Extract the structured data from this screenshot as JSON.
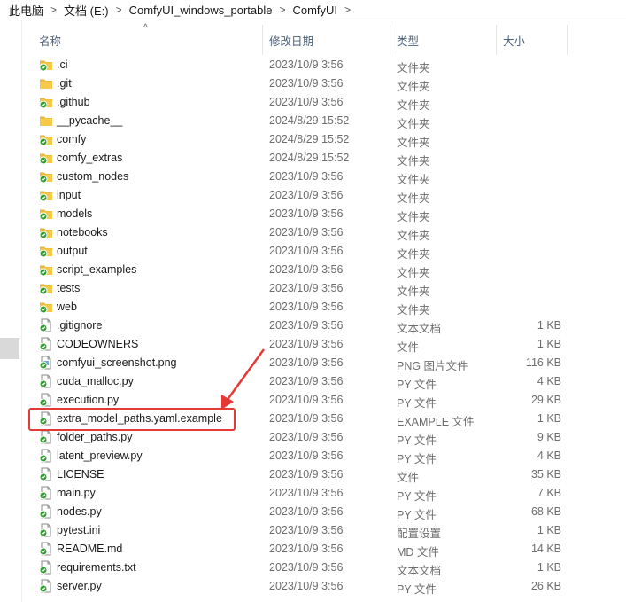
{
  "breadcrumb": [
    "此电脑",
    "文档 (E:)",
    "ComfyUI_windows_portable",
    "ComfyUI"
  ],
  "columns": {
    "name": "名称",
    "date": "修改日期",
    "type": "类型",
    "size": "大小"
  },
  "colors": {
    "folder": "#f6c948",
    "sync_green": "#2e9d2e",
    "highlight": "#e53935"
  },
  "files": [
    {
      "name": ".ci",
      "date": "2023/10/9 3:56",
      "type": "文件夹",
      "size": "",
      "icon": "folder-synced-icon"
    },
    {
      "name": ".git",
      "date": "2023/10/9 3:56",
      "type": "文件夹",
      "size": "",
      "icon": "folder-icon"
    },
    {
      "name": ".github",
      "date": "2023/10/9 3:56",
      "type": "文件夹",
      "size": "",
      "icon": "folder-synced-icon"
    },
    {
      "name": "__pycache__",
      "date": "2024/8/29 15:52",
      "type": "文件夹",
      "size": "",
      "icon": "folder-icon"
    },
    {
      "name": "comfy",
      "date": "2024/8/29 15:52",
      "type": "文件夹",
      "size": "",
      "icon": "folder-synced-icon"
    },
    {
      "name": "comfy_extras",
      "date": "2024/8/29 15:52",
      "type": "文件夹",
      "size": "",
      "icon": "folder-synced-icon"
    },
    {
      "name": "custom_nodes",
      "date": "2023/10/9 3:56",
      "type": "文件夹",
      "size": "",
      "icon": "folder-synced-icon"
    },
    {
      "name": "input",
      "date": "2023/10/9 3:56",
      "type": "文件夹",
      "size": "",
      "icon": "folder-synced-icon"
    },
    {
      "name": "models",
      "date": "2023/10/9 3:56",
      "type": "文件夹",
      "size": "",
      "icon": "folder-synced-icon"
    },
    {
      "name": "notebooks",
      "date": "2023/10/9 3:56",
      "type": "文件夹",
      "size": "",
      "icon": "folder-synced-icon"
    },
    {
      "name": "output",
      "date": "2023/10/9 3:56",
      "type": "文件夹",
      "size": "",
      "icon": "folder-synced-icon"
    },
    {
      "name": "script_examples",
      "date": "2023/10/9 3:56",
      "type": "文件夹",
      "size": "",
      "icon": "folder-synced-icon"
    },
    {
      "name": "tests",
      "date": "2023/10/9 3:56",
      "type": "文件夹",
      "size": "",
      "icon": "folder-synced-icon"
    },
    {
      "name": "web",
      "date": "2023/10/9 3:56",
      "type": "文件夹",
      "size": "",
      "icon": "folder-synced-icon"
    },
    {
      "name": ".gitignore",
      "date": "2023/10/9 3:56",
      "type": "文本文档",
      "size": "1 KB",
      "icon": "file-synced-icon"
    },
    {
      "name": "CODEOWNERS",
      "date": "2023/10/9 3:56",
      "type": "文件",
      "size": "1 KB",
      "icon": "file-synced-icon"
    },
    {
      "name": "comfyui_screenshot.png",
      "date": "2023/10/9 3:56",
      "type": "PNG 图片文件",
      "size": "116 KB",
      "icon": "image-synced-icon"
    },
    {
      "name": "cuda_malloc.py",
      "date": "2023/10/9 3:56",
      "type": "PY 文件",
      "size": "4 KB",
      "icon": "file-synced-icon"
    },
    {
      "name": "execution.py",
      "date": "2023/10/9 3:56",
      "type": "PY 文件",
      "size": "29 KB",
      "icon": "file-synced-icon"
    },
    {
      "name": "extra_model_paths.yaml.example",
      "date": "2023/10/9 3:56",
      "type": "EXAMPLE 文件",
      "size": "1 KB",
      "icon": "file-synced-icon"
    },
    {
      "name": "folder_paths.py",
      "date": "2023/10/9 3:56",
      "type": "PY 文件",
      "size": "9 KB",
      "icon": "file-synced-icon"
    },
    {
      "name": "latent_preview.py",
      "date": "2023/10/9 3:56",
      "type": "PY 文件",
      "size": "4 KB",
      "icon": "file-synced-icon"
    },
    {
      "name": "LICENSE",
      "date": "2023/10/9 3:56",
      "type": "文件",
      "size": "35 KB",
      "icon": "file-synced-icon"
    },
    {
      "name": "main.py",
      "date": "2023/10/9 3:56",
      "type": "PY 文件",
      "size": "7 KB",
      "icon": "file-synced-icon"
    },
    {
      "name": "nodes.py",
      "date": "2023/10/9 3:56",
      "type": "PY 文件",
      "size": "68 KB",
      "icon": "file-synced-icon"
    },
    {
      "name": "pytest.ini",
      "date": "2023/10/9 3:56",
      "type": "配置设置",
      "size": "1 KB",
      "icon": "file-synced-icon"
    },
    {
      "name": "README.md",
      "date": "2023/10/9 3:56",
      "type": "MD 文件",
      "size": "14 KB",
      "icon": "file-synced-icon"
    },
    {
      "name": "requirements.txt",
      "date": "2023/10/9 3:56",
      "type": "文本文档",
      "size": "1 KB",
      "icon": "file-synced-icon"
    },
    {
      "name": "server.py",
      "date": "2023/10/9 3:56",
      "type": "PY 文件",
      "size": "26 KB",
      "icon": "file-synced-icon"
    }
  ]
}
